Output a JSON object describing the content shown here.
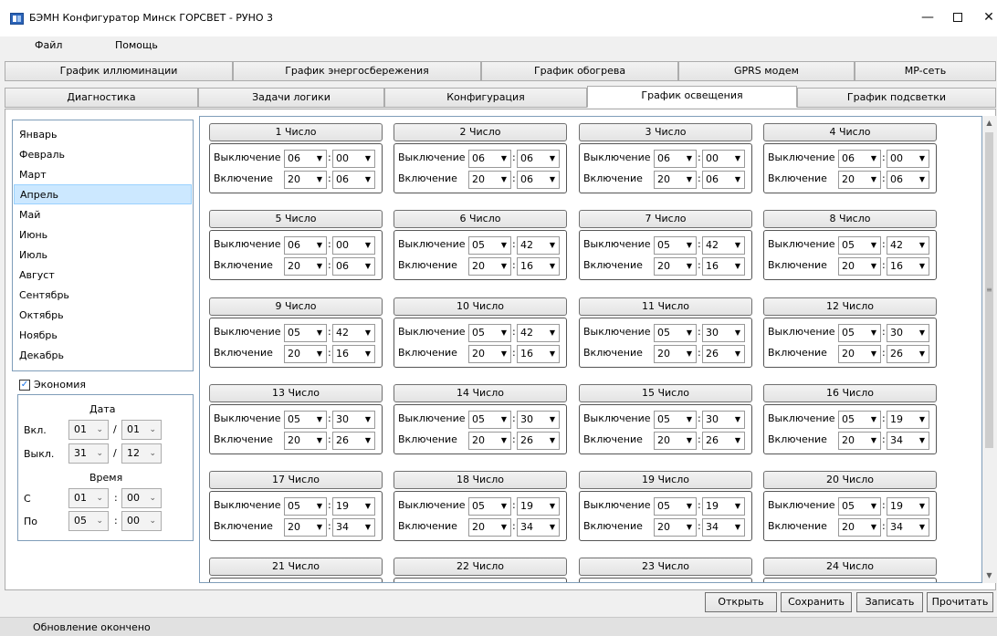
{
  "window": {
    "title": "БЭМН Конфигуратор Минск ГОРСВЕТ - РУНО 3",
    "min": "—",
    "max": "",
    "close": "✕"
  },
  "menu": {
    "file": "Файл",
    "help": "Помощь"
  },
  "tabs_row1": [
    "График иллюминации",
    "График энергосбережения",
    "График обогрева",
    "GPRS модем",
    "MP-сеть"
  ],
  "tabs_row2": [
    "Диагностика",
    "Задачи логики",
    "Конфигурация",
    "График освещения",
    "График подсветки"
  ],
  "active_tab": "График освещения",
  "months": [
    "Январь",
    "Февраль",
    "Март",
    "Апрель",
    "Май",
    "Июнь",
    "Июль",
    "Август",
    "Сентябрь",
    "Октябрь",
    "Ноябрь",
    "Декабрь"
  ],
  "selected_month": "Апрель",
  "economy": {
    "checkbox_label": "Экономия",
    "checked": true,
    "date_header": "Дата",
    "on_label": "Вкл.",
    "off_label": "Выкл.",
    "on_day": "01",
    "on_month": "01",
    "off_day": "31",
    "off_month": "12",
    "time_header": "Время",
    "from_label": "С",
    "to_label": "По",
    "from_hour": "01",
    "from_min": "00",
    "to_hour": "05",
    "to_min": "00",
    "slash": "/",
    "colon": ":"
  },
  "days": [
    {
      "label": "1 Число",
      "off_h": "06",
      "off_m": "00",
      "on_h": "20",
      "on_m": "06"
    },
    {
      "label": "2 Число",
      "off_h": "06",
      "off_m": "06",
      "on_h": "20",
      "on_m": "06"
    },
    {
      "label": "3 Число",
      "off_h": "06",
      "off_m": "00",
      "on_h": "20",
      "on_m": "06"
    },
    {
      "label": "4 Число",
      "off_h": "06",
      "off_m": "00",
      "on_h": "20",
      "on_m": "06"
    },
    {
      "label": "5 Число",
      "off_h": "06",
      "off_m": "00",
      "on_h": "20",
      "on_m": "06"
    },
    {
      "label": "6 Число",
      "off_h": "05",
      "off_m": "42",
      "on_h": "20",
      "on_m": "16"
    },
    {
      "label": "7 Число",
      "off_h": "05",
      "off_m": "42",
      "on_h": "20",
      "on_m": "16"
    },
    {
      "label": "8 Число",
      "off_h": "05",
      "off_m": "42",
      "on_h": "20",
      "on_m": "16"
    },
    {
      "label": "9 Число",
      "off_h": "05",
      "off_m": "42",
      "on_h": "20",
      "on_m": "16"
    },
    {
      "label": "10 Число",
      "off_h": "05",
      "off_m": "42",
      "on_h": "20",
      "on_m": "16"
    },
    {
      "label": "11 Число",
      "off_h": "05",
      "off_m": "30",
      "on_h": "20",
      "on_m": "26"
    },
    {
      "label": "12 Число",
      "off_h": "05",
      "off_m": "30",
      "on_h": "20",
      "on_m": "26"
    },
    {
      "label": "13 Число",
      "off_h": "05",
      "off_m": "30",
      "on_h": "20",
      "on_m": "26"
    },
    {
      "label": "14 Число",
      "off_h": "05",
      "off_m": "30",
      "on_h": "20",
      "on_m": "26"
    },
    {
      "label": "15 Число",
      "off_h": "05",
      "off_m": "30",
      "on_h": "20",
      "on_m": "26"
    },
    {
      "label": "16 Число",
      "off_h": "05",
      "off_m": "19",
      "on_h": "20",
      "on_m": "34"
    },
    {
      "label": "17 Число",
      "off_h": "05",
      "off_m": "19",
      "on_h": "20",
      "on_m": "34"
    },
    {
      "label": "18 Число",
      "off_h": "05",
      "off_m": "19",
      "on_h": "20",
      "on_m": "34"
    },
    {
      "label": "19 Число",
      "off_h": "05",
      "off_m": "19",
      "on_h": "20",
      "on_m": "34"
    },
    {
      "label": "20 Число",
      "off_h": "05",
      "off_m": "19",
      "on_h": "20",
      "on_m": "34"
    },
    {
      "label": "21 Число"
    },
    {
      "label": "22 Число"
    },
    {
      "label": "23 Число"
    },
    {
      "label": "24 Число"
    }
  ],
  "row_labels": {
    "off": "Выключение",
    "on": "Включение"
  },
  "buttons": {
    "open": "Открыть",
    "save": "Сохранить",
    "write": "Записать",
    "read": "Прочитать"
  },
  "status": "Обновление окончено",
  "scroll": {
    "up": "▲",
    "down": "▼",
    "grip": "≡"
  }
}
